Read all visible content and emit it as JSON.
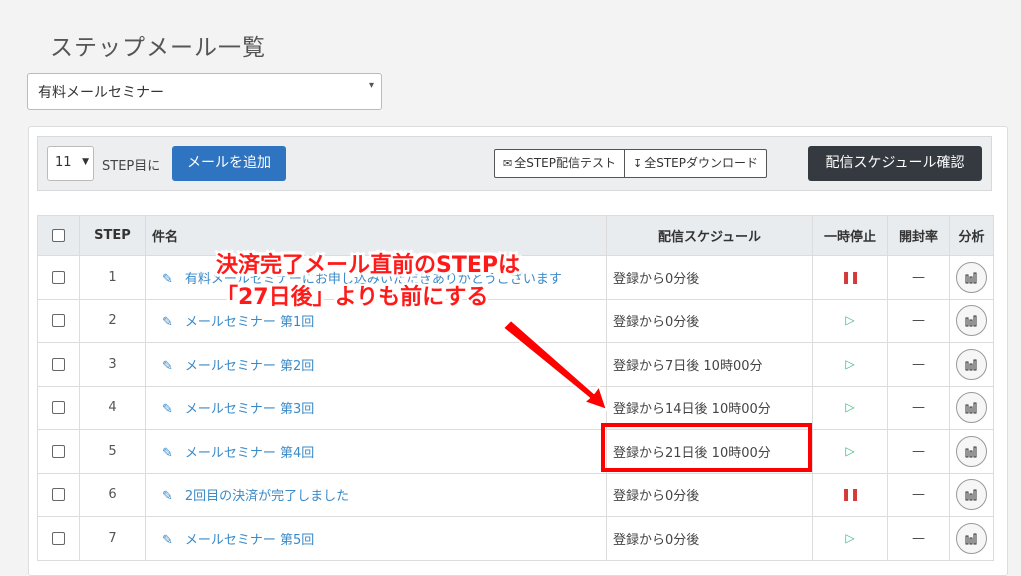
{
  "page_title": "ステップメール一覧",
  "list_select": {
    "value": "有料メールセミナー",
    "caret": "▾"
  },
  "toolbar": {
    "step_select_value": "11",
    "step_suffix": "STEP目に",
    "add_mail_label": "メールを追加",
    "all_step_test_label": "全STEP配信テスト",
    "all_step_download_label": "全STEPダウンロード",
    "schedule_check_label": "配信スケジュール確認"
  },
  "table": {
    "headers": {
      "step": "STEP",
      "subject": "件名",
      "schedule": "配信スケジュール",
      "pause": "一時停止",
      "open_rate": "開封率",
      "analysis": "分析"
    },
    "rows": [
      {
        "step": "1",
        "subject": "有料メールセミナーにお申し込みいただきありがとうございます",
        "schedule": "登録から0分後",
        "status": "paused",
        "rate": "—"
      },
      {
        "step": "2",
        "subject": "メールセミナー 第1回",
        "schedule": "登録から0分後",
        "status": "active",
        "rate": "—"
      },
      {
        "step": "3",
        "subject": "メールセミナー 第2回",
        "schedule": "登録から7日後 10時00分",
        "status": "active",
        "rate": "—"
      },
      {
        "step": "4",
        "subject": "メールセミナー 第3回",
        "schedule": "登録から14日後 10時00分",
        "status": "active",
        "rate": "—"
      },
      {
        "step": "5",
        "subject": "メールセミナー 第4回",
        "schedule": "登録から21日後 10時00分",
        "status": "active",
        "rate": "—"
      },
      {
        "step": "6",
        "subject": "2回目の決済が完了しました",
        "schedule": "登録から0分後",
        "status": "paused",
        "rate": "—"
      },
      {
        "step": "7",
        "subject": "メールセミナー 第5回",
        "schedule": "登録から0分後",
        "status": "active",
        "rate": "—"
      }
    ]
  },
  "annotation": {
    "line1": "決済完了メール直前のSTEPは",
    "line2": "「27日後」よりも前にする",
    "color": "#ff0000"
  },
  "colors": {
    "primary": "#2f74c0",
    "dark": "#343a40",
    "link": "#3a8ac8",
    "pause": "#d43a3a",
    "play": "#3bb57a"
  }
}
